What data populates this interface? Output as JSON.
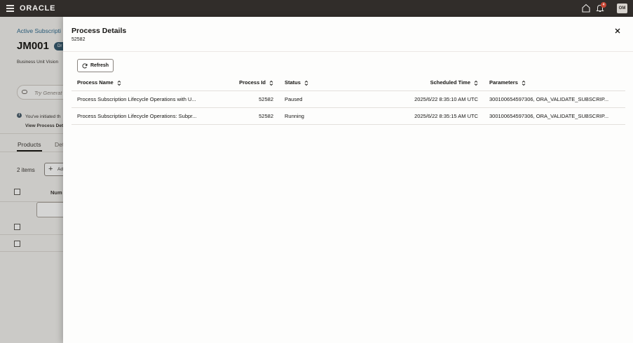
{
  "topbar": {
    "brand": "ORACLE",
    "notification_count": "4",
    "avatar_initials": "OM"
  },
  "background_page": {
    "breadcrumb": "Active Subscripti",
    "title": "JM001",
    "status_chip": "Dr",
    "business_unit": "Business Unit Vision",
    "search_placeholder": "Try Generat",
    "info_line1": "You've initiated th",
    "info_line2": "View Process Det",
    "tab_products": "Products",
    "tab_details": "Det",
    "items_count": "2 items",
    "add_label": "Ad",
    "column_num": "Num"
  },
  "drawer": {
    "title": "Process Details",
    "subtitle": "52582",
    "refresh_label": "Refresh",
    "columns": {
      "name": "Process Name",
      "id": "Process Id",
      "status": "Status",
      "time": "Scheduled Time",
      "params": "Parameters"
    },
    "rows": [
      {
        "name": "Process Subscription Lifecycle Operations with U...",
        "id": "52582",
        "status": "Paused",
        "time": "2025/6/22 8:35:10 AM UTC",
        "params": "300100654597306, ORA_VALIDATE_SUBSCRIP..."
      },
      {
        "name": "Process Subscription Lifecycle Operations: Subpr...",
        "id": "52582",
        "status": "Running",
        "time": "2025/6/22 8:35:15 AM UTC",
        "params": "300100654597306, ORA_VALIDATE_SUBSCRIP..."
      }
    ]
  }
}
